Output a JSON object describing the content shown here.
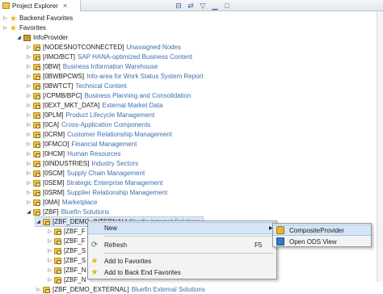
{
  "view": {
    "title": "Project Explorer",
    "close_glyph": "×",
    "toolbar_icons": [
      "collapse-all-icon",
      "link-editor-icon",
      "view-menu-icon",
      "minimize-icon",
      "maximize-icon"
    ]
  },
  "tree": {
    "favorites": "Backend Favorites",
    "favorites2": "Favorites",
    "infoprovider": "InfoProvider",
    "nodes": [
      {
        "code": "[NODESNOTCONNECTED]",
        "desc": "Unassigned Nodes"
      },
      {
        "code": "[/IMO/BCT]",
        "desc": "SAP HANA-optimized Business Content"
      },
      {
        "code": "[0BW]",
        "desc": "Business Information Warehouse"
      },
      {
        "code": "[0BWBPCWS]",
        "desc": "Info-area for Work Status System Report"
      },
      {
        "code": "[0BWTCT]",
        "desc": "Technical Content"
      },
      {
        "code": "[/CPMB/BPC]",
        "desc": "Business Planning and Consolidation"
      },
      {
        "code": "[0EXT_MKT_DATA]",
        "desc": "External Market Data"
      },
      {
        "code": "[0PLM]",
        "desc": "Product Lifecycle Management"
      },
      {
        "code": "[0CA]",
        "desc": "Cross-Application Components"
      },
      {
        "code": "[0CRM]",
        "desc": "Customer Relationship Management"
      },
      {
        "code": "[0FMCO]",
        "desc": "Financial Management"
      },
      {
        "code": "[0HCM]",
        "desc": "Human Resources"
      },
      {
        "code": "[0INDUSTRIES]",
        "desc": "Industry Sectors"
      },
      {
        "code": "[0SCM]",
        "desc": "Supply Chain Management"
      },
      {
        "code": "[0SEM]",
        "desc": "Strategic Enterprise Management"
      },
      {
        "code": "[0SRM]",
        "desc": "Supplier Relationship Management"
      },
      {
        "code": "[0MA]",
        "desc": "Marketplace"
      },
      {
        "code": "[ZBF]",
        "desc": "Bluefin Solutions"
      }
    ],
    "selected": {
      "code": "[ZBF_DEMO_INTERNAL]",
      "desc": "Bluefin Internal Solutions"
    },
    "children": [
      {
        "code": "[ZBF_F"
      },
      {
        "code": "[ZBF_F"
      },
      {
        "code": "[ZBF_S"
      },
      {
        "code": "[ZBF_S"
      },
      {
        "code": "[ZBF_N"
      },
      {
        "code": "[ZBF_N"
      }
    ],
    "last": {
      "code": "[ZBF_DEMO_EXTERNAL]",
      "desc": "Bluefin External Solutions"
    }
  },
  "context_menu": {
    "new": "New",
    "refresh": "Refresh",
    "refresh_key": "F5",
    "add_favorites": "Add to Favorites",
    "add_backend": "Add to Back End Favorites",
    "arrow": "▶"
  },
  "submenu": {
    "composite": "CompositeProvider",
    "open_ods": "Open ODS View"
  }
}
